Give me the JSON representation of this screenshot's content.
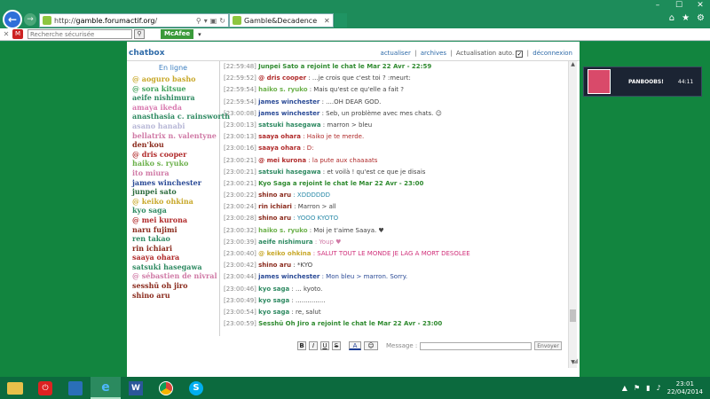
{
  "browser": {
    "url_prefix": "http://",
    "url_domain": "gamble.forumactif.org",
    "url_suffix": "/",
    "tab_title": "Gamble&Decadence",
    "search_placeholder": "Recherche sécurisée",
    "mcafee_label": "McAfee"
  },
  "chat": {
    "title": "chatbox",
    "link_refresh": "actualiser",
    "link_archives": "archives",
    "auto_label": "Actualisation auto.",
    "link_disconnect": "déconnexion",
    "online_title": "En ligne",
    "users": [
      {
        "name": "@ aoguro basho",
        "color": "#c8a82a"
      },
      {
        "name": "@ sora kitsue",
        "color": "#3fa25a"
      },
      {
        "name": "aeife nishimura",
        "color": "#2f8a62"
      },
      {
        "name": "amaya ikeda",
        "color": "#d97ab0"
      },
      {
        "name": "anasthasia c. rainsworth",
        "color": "#2f8a62"
      },
      {
        "name": "asano hanabi",
        "color": "#b7b7d6"
      },
      {
        "name": "bellatrix n. valentyne",
        "color": "#d07aa6"
      },
      {
        "name": "den'kou",
        "color": "#8a2a1c"
      },
      {
        "name": "@ dris cooper",
        "color": "#b02a2a"
      },
      {
        "name": "haiko s. ryuko",
        "color": "#6bb04a"
      },
      {
        "name": "ito miura",
        "color": "#d07aa6"
      },
      {
        "name": "james winchester",
        "color": "#2a4a96"
      },
      {
        "name": "junpei sato",
        "color": "#2a6a3c"
      },
      {
        "name": "@ keiko ohkina",
        "color": "#c8a82a"
      },
      {
        "name": "kyo saga",
        "color": "#2f8a62"
      },
      {
        "name": "@ mei kurona",
        "color": "#b02a2a"
      },
      {
        "name": "naru fujimi",
        "color": "#8a2a1c"
      },
      {
        "name": "ren takao",
        "color": "#2f8a62"
      },
      {
        "name": "rin ichiari",
        "color": "#8a2a1c"
      },
      {
        "name": "saaya ohara",
        "color": "#b02a2a"
      },
      {
        "name": "satsuki hasegawa",
        "color": "#2f8a62"
      },
      {
        "name": "@ sébastien de nivral",
        "color": "#d07aa6"
      },
      {
        "name": "sesshū oh jiro",
        "color": "#8a2a1c"
      },
      {
        "name": "shino aru",
        "color": "#8a2a1c"
      }
    ],
    "messages": [
      {
        "ts": "[22:59:48]",
        "who": "",
        "text": "Junpei Sato a rejoint le chat le Mar 22 Avr - 22:59",
        "who_color": "#2f8a2f",
        "text_color": "#2f8a2f",
        "sys": true
      },
      {
        "ts": "[22:59:52]",
        "who": "@ dris cooper",
        "text": " : ...je crois que c'est toi ? :meurt:",
        "who_color": "#b02a2a",
        "text_color": "#444",
        "sys": false
      },
      {
        "ts": "[22:59:54]",
        "who": "haiko s. ryuko",
        "text": " : Mais qu'est ce qu'elle a fait ?",
        "who_color": "#6bb04a",
        "text_color": "#444",
        "sys": false
      },
      {
        "ts": "[22:59:54]",
        "who": "james winchester",
        "text": " : ....OH DEAR GOD.",
        "who_color": "#2a4a96",
        "text_color": "#444",
        "sys": false
      },
      {
        "ts": "[23:00:08]",
        "who": "james winchester",
        "text": " : Seb, un problème avec mes chats. ☺",
        "who_color": "#2a4a96",
        "text_color": "#444",
        "sys": false
      },
      {
        "ts": "[23:00:13]",
        "who": "satsuki hasegawa",
        "text": " : marron > bleu",
        "who_color": "#2f8a62",
        "text_color": "#444",
        "sys": false
      },
      {
        "ts": "[23:00:13]",
        "who": "saaya ohara",
        "text": " : Haiko je te merde.",
        "who_color": "#b02a2a",
        "text_color": "#b02a2a",
        "sys": false
      },
      {
        "ts": "[23:00:16]",
        "who": "saaya ohara",
        "text": " : D:",
        "who_color": "#b02a2a",
        "text_color": "#b02a2a",
        "sys": false
      },
      {
        "ts": "[23:00:21]",
        "who": "@ mei kurona",
        "text": " : la pute aux chaaaats",
        "who_color": "#b02a2a",
        "text_color": "#b02a2a",
        "sys": false
      },
      {
        "ts": "[23:00:21]",
        "who": "satsuki hasegawa",
        "text": " : et voilà ! qu'est ce que je disais",
        "who_color": "#2f8a62",
        "text_color": "#444",
        "sys": false
      },
      {
        "ts": "[23:00:21]",
        "who": "",
        "text": "Kyo Saga a rejoint le chat le Mar 22 Avr - 23:00",
        "who_color": "#2f8a2f",
        "text_color": "#2f8a2f",
        "sys": true
      },
      {
        "ts": "[23:00:22]",
        "who": "shino aru",
        "text": " : XDDDDDD",
        "who_color": "#8a2a1c",
        "text_color": "#2a8aa8",
        "sys": false
      },
      {
        "ts": "[23:00:24]",
        "who": "rin ichiari",
        "text": " : Marron > all",
        "who_color": "#8a2a1c",
        "text_color": "#444",
        "sys": false
      },
      {
        "ts": "[23:00:28]",
        "who": "shino aru",
        "text": " : YOOO KYOTO",
        "who_color": "#8a2a1c",
        "text_color": "#2a8aa8",
        "sys": false
      },
      {
        "ts": "[23:00:32]",
        "who": "haiko s. ryuko",
        "text": " : Moi je t'aime Saaya. ♥",
        "who_color": "#6bb04a",
        "text_color": "#444",
        "sys": false
      },
      {
        "ts": "[23:00:39]",
        "who": "aeife nishimura",
        "text": " : Youp ♥",
        "who_color": "#2f8a62",
        "text_color": "#d07aa6",
        "sys": false
      },
      {
        "ts": "[23:00:40]",
        "who": "@ keiko ohkina",
        "text": " : SALUT TOUT LE MONDE JE LAG A MORT DESOLEE",
        "who_color": "#c8a82a",
        "text_color": "#d0307a",
        "sys": false
      },
      {
        "ts": "[23:00:42]",
        "who": "shino aru",
        "text": " : *KYO",
        "who_color": "#8a2a1c",
        "text_color": "#444",
        "sys": false
      },
      {
        "ts": "[23:00:44]",
        "who": "james winchester",
        "text": " : Mon bleu > marron. Sorry.",
        "who_color": "#2a4a96",
        "text_color": "#2a4a96",
        "sys": false
      },
      {
        "ts": "[23:00:46]",
        "who": "kyo saga",
        "text": " : ... kyoto.",
        "who_color": "#2f8a62",
        "text_color": "#444",
        "sys": false
      },
      {
        "ts": "[23:00:49]",
        "who": "kyo saga",
        "text": " : ...............",
        "who_color": "#2f8a62",
        "text_color": "#444",
        "sys": false
      },
      {
        "ts": "[23:00:54]",
        "who": "kyo saga",
        "text": " : re, salut",
        "who_color": "#2f8a62",
        "text_color": "#444",
        "sys": false
      },
      {
        "ts": "[23:00:59]",
        "who": "",
        "text": "Sesshū Oh Jiro a rejoint le chat le Mar 22 Avr - 23:00",
        "who_color": "#2f8a2f",
        "text_color": "#2f8a2f",
        "sys": true
      }
    ],
    "toolbar": {
      "bold": "B",
      "italic": "I",
      "underline": "U",
      "strike": "S",
      "color": "A",
      "emoji": "☺",
      "message_label": "Message :",
      "send_label": "Envoyer"
    }
  },
  "ad": {
    "title": "PANBOOBS!",
    "duration": "44:11"
  },
  "taskbar": {
    "time": "23:01",
    "date": "22/04/2014"
  }
}
